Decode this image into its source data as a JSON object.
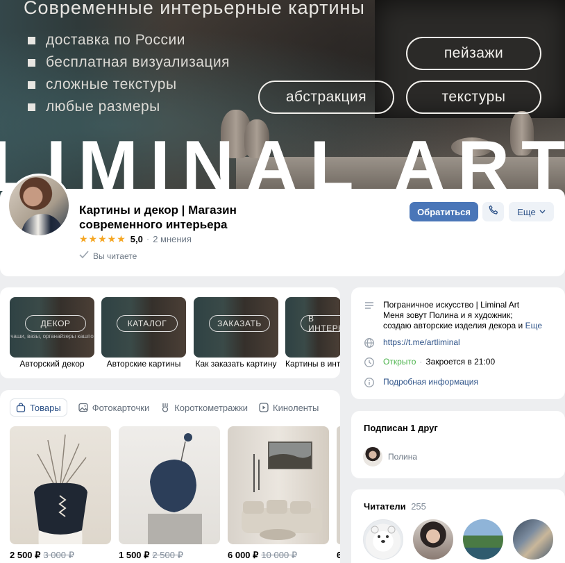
{
  "cover": {
    "title": "Современные интерьерные картины",
    "bullets": [
      "доставка по России",
      "бесплатная визуализация",
      "сложные текстуры",
      "любые размеры"
    ],
    "pills": [
      "пейзажи",
      "абстракция",
      "текстуры"
    ],
    "brand": "LIMINAL ART"
  },
  "profile": {
    "name": "Картины и декор | Магазин современного интерьера",
    "stars": "★★★★★",
    "rating": "5,0",
    "separator": "·",
    "reviews": "2 мнения",
    "following_status": "Вы читаете",
    "contact_button": "Обратиться",
    "more_button": "Еще"
  },
  "highlights": [
    {
      "ring": "ДЕКОР",
      "sub": "чаши, вазы, органайзеры кашпо",
      "label": "Авторский декор"
    },
    {
      "ring": "КАТАЛОГ",
      "sub": "",
      "label": "Авторские картины"
    },
    {
      "ring": "ЗАКАЗАТЬ",
      "sub": "",
      "label": "Как заказать картину"
    },
    {
      "ring": "В ИНТЕРЬ",
      "sub": "",
      "label": "Картины в инт"
    }
  ],
  "tabs": [
    "Товары",
    "Фотокарточки",
    "Короткометражки",
    "Киноленты"
  ],
  "products": [
    {
      "price": "2 500 ₽",
      "old_price": "3 000 ₽"
    },
    {
      "price": "1 500 ₽",
      "old_price": "2 500 ₽"
    },
    {
      "price": "6 000 ₽",
      "old_price": "10 000 ₽"
    },
    {
      "price": "6",
      "old_price": ""
    }
  ],
  "info": {
    "description": "Пограничное искусство | Liminal Art\nМеня зовут Полина и я художник;\nсоздаю авторские изделия декора и",
    "description_more": "Еще",
    "link": "https://t.me/artliminal",
    "status_open": "Открыто",
    "status_separator": "·",
    "status_closes": "Закроется в 21:00",
    "details": "Подробная информация"
  },
  "friends": {
    "title": "Подписан 1 друг",
    "friend_name": "Полина"
  },
  "readers": {
    "title": "Читатели",
    "count": "255"
  },
  "colors": {
    "accent": "#4a76b8",
    "link": "#2d5288",
    "open_green": "#4bb34b",
    "page_bg": "#edeef0",
    "star": "#f5a623"
  }
}
